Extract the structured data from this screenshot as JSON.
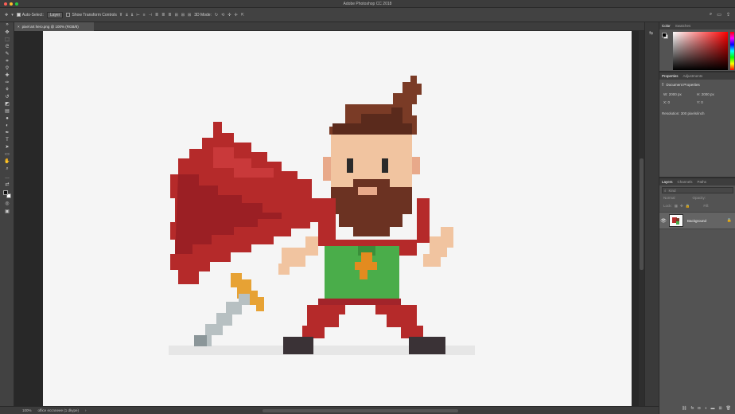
{
  "window": {
    "title": "Adobe Photoshop CC 2018",
    "traffic_colors": [
      "#fd5f57",
      "#febc2e",
      "#28c840"
    ]
  },
  "options_bar": {
    "move_icon": "move-tool-icon",
    "auto_select_label": "Auto-Select:",
    "auto_select_value": "Layer",
    "show_transform_label": "Show Transform Controls",
    "mode_3d_label": "3D Mode:"
  },
  "document_tab": {
    "label": "pixel art hero.png @ 100% (RGB/8)",
    "close": "×"
  },
  "status_bar": {
    "zoom": "100%",
    "info": "office eccnneee (1 dkype)",
    "arrow": "›"
  },
  "panels": {
    "color": {
      "tabs": [
        "Color",
        "Swatches"
      ],
      "active": "Color",
      "foreground": "#000000",
      "background": "#ffffff"
    },
    "properties": {
      "tabs": [
        "Properties",
        "Adjustments"
      ],
      "active": "Properties",
      "heading": "Document Properties",
      "w_label": "W:",
      "w_value": "2000 px",
      "h_label": "H:",
      "h_value": "2000 px",
      "x_label": "X:",
      "x_value": "0",
      "y_label": "Y:",
      "y_value": "0",
      "resolution": "Resolution: 300 pixels/inch"
    },
    "layers": {
      "tabs": [
        "Layers",
        "Channels",
        "Paths"
      ],
      "active": "Layers",
      "search_kind": "Kind",
      "blend_mode": "Normal",
      "opacity_label": "Opacity:",
      "lock_label": "Lock:",
      "fill_label": "Fill:",
      "layer_name": "Background"
    }
  }
}
